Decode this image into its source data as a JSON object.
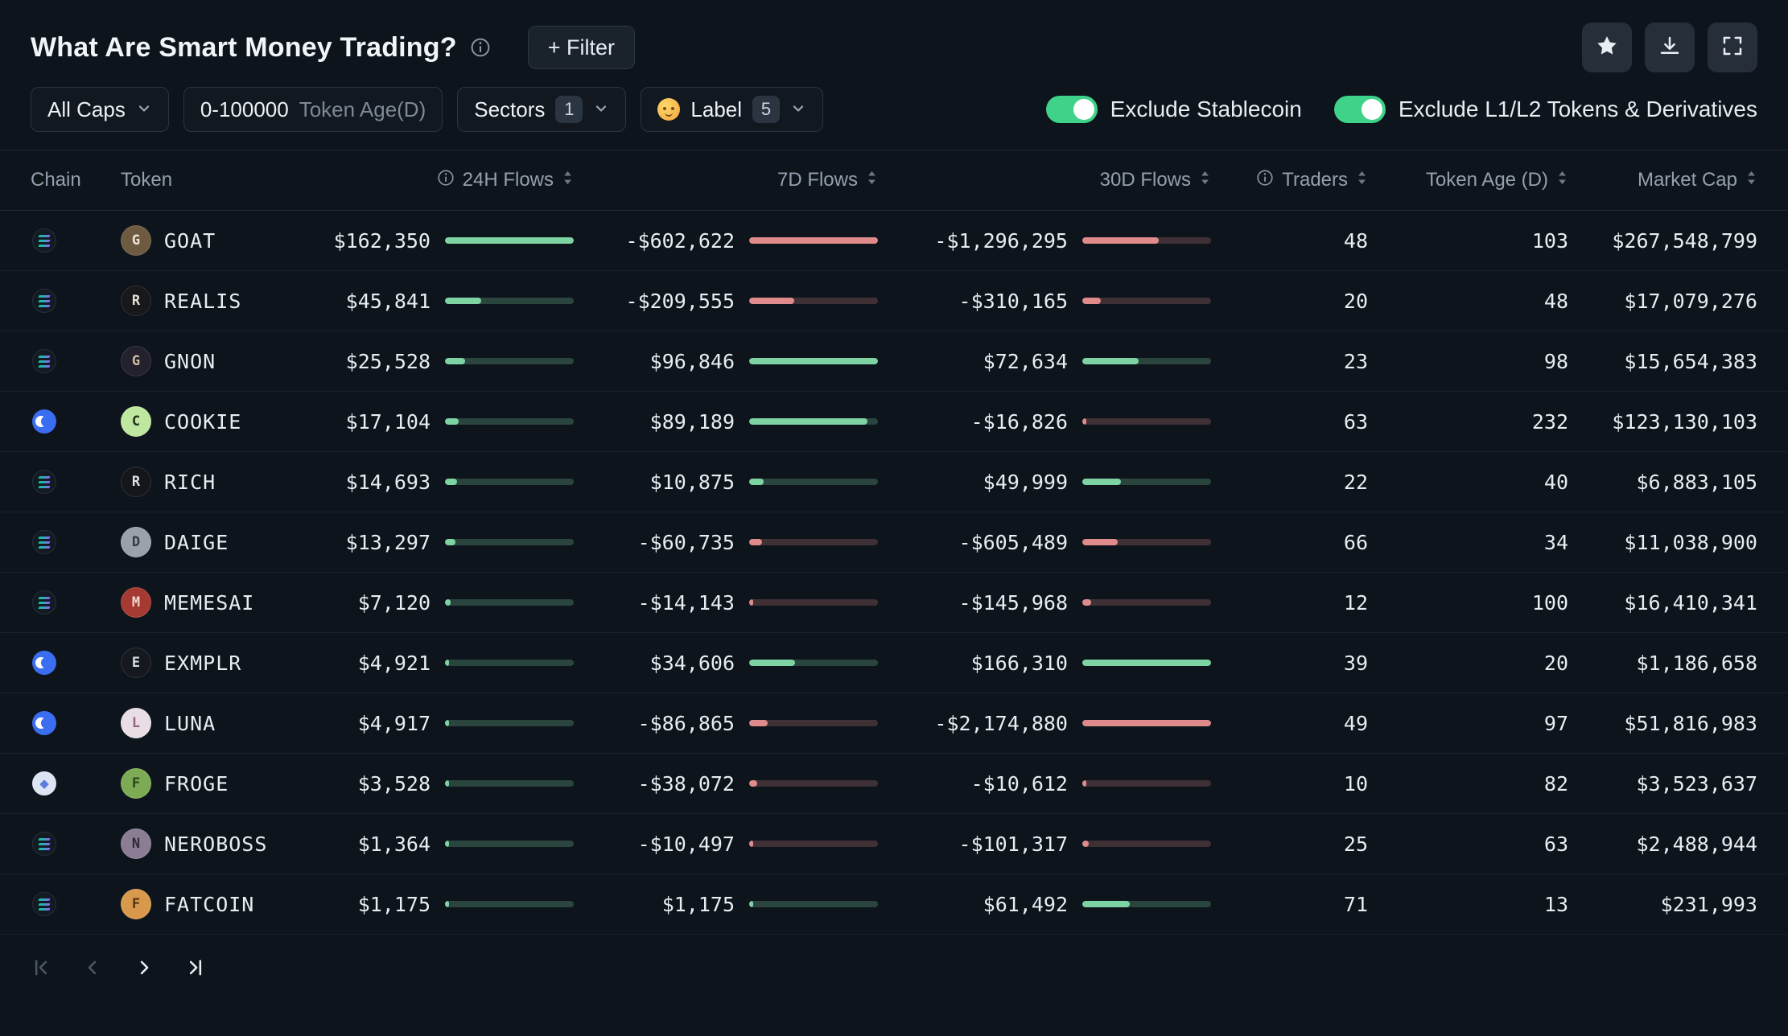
{
  "page": {
    "title": "What Are Smart Money Trading?",
    "filter_button": "+ Filter"
  },
  "toolbar": {
    "action_icons": [
      "star",
      "download",
      "fullscreen"
    ]
  },
  "filters": {
    "caps": {
      "label": "All Caps"
    },
    "token_age": {
      "value": "0-100000",
      "label": "Token Age(D)"
    },
    "sectors": {
      "label": "Sectors",
      "count": "1"
    },
    "label": {
      "icon": "cowboy-face-emoji",
      "label": "Label",
      "count": "5"
    }
  },
  "toggles": {
    "stablecoin": {
      "label": "Exclude Stablecoin",
      "on": true
    },
    "l1l2": {
      "label": "Exclude L1/L2 Tokens & Derivatives",
      "on": true
    }
  },
  "table": {
    "columns": [
      {
        "label": "Chain",
        "sortable": false
      },
      {
        "label": "Token",
        "sortable": false
      },
      {
        "label": "24H Flows",
        "info": true,
        "sortable": true
      },
      {
        "label": "7D Flows",
        "sortable": true
      },
      {
        "label": "30D Flows",
        "sortable": true
      },
      {
        "label": "Traders",
        "info": true,
        "sortable": true
      },
      {
        "label": "Token Age (D)",
        "sortable": true
      },
      {
        "label": "Market Cap",
        "sortable": true
      }
    ],
    "rows": [
      {
        "chain": "solana",
        "token": "GOAT",
        "flows": {
          "h24": 162350,
          "d7": -602622,
          "d30": -1296295
        },
        "traders": 48,
        "token_age": 103,
        "market_cap": 267548799,
        "avatar": {
          "bg": "#6d5a41",
          "fg": "#f0e6d8"
        }
      },
      {
        "chain": "solana",
        "token": "REALIS",
        "flows": {
          "h24": 45841,
          "d7": -209555,
          "d30": -310165
        },
        "traders": 20,
        "token_age": 48,
        "market_cap": 17079276,
        "avatar": {
          "bg": "#17171c",
          "fg": "#e8e2d2"
        }
      },
      {
        "chain": "solana",
        "token": "GNON",
        "flows": {
          "h24": 25528,
          "d7": 96846,
          "d30": 72634
        },
        "traders": 23,
        "token_age": 98,
        "market_cap": 15654383,
        "avatar": {
          "bg": "#24212c",
          "fg": "#cdbfa4"
        }
      },
      {
        "chain": "base",
        "token": "COOKIE",
        "flows": {
          "h24": 17104,
          "d7": 89189,
          "d30": -16826
        },
        "traders": 63,
        "token_age": 232,
        "market_cap": 123130103,
        "avatar": {
          "bg": "#bfe7a0",
          "fg": "#23301c"
        }
      },
      {
        "chain": "solana",
        "token": "RICH",
        "flows": {
          "h24": 14693,
          "d7": 10875,
          "d30": 49999
        },
        "traders": 22,
        "token_age": 40,
        "market_cap": 6883105,
        "avatar": {
          "bg": "#14161b",
          "fg": "#dfe3e8"
        }
      },
      {
        "chain": "solana",
        "token": "DAIGE",
        "flows": {
          "h24": 13297,
          "d7": -60735,
          "d30": -605489
        },
        "traders": 66,
        "token_age": 34,
        "market_cap": 11038900,
        "avatar": {
          "bg": "#9aa1a9",
          "fg": "#343a42"
        }
      },
      {
        "chain": "solana",
        "token": "MEMESAI",
        "flows": {
          "h24": 7120,
          "d7": -14143,
          "d30": -145968
        },
        "traders": 12,
        "token_age": 100,
        "market_cap": 16410341,
        "avatar": {
          "bg": "#a63a33",
          "fg": "#f2d8d0"
        }
      },
      {
        "chain": "base",
        "token": "EXMPLR",
        "flows": {
          "h24": 4921,
          "d7": 34606,
          "d30": 166310
        },
        "traders": 39,
        "token_age": 20,
        "market_cap": 1186658,
        "avatar": {
          "bg": "#15181f",
          "fg": "#d6dde6"
        }
      },
      {
        "chain": "base",
        "token": "LUNA",
        "flows": {
          "h24": 4917,
          "d7": -86865,
          "d30": -2174880
        },
        "traders": 49,
        "token_age": 97,
        "market_cap": 51816983,
        "avatar": {
          "bg": "#e9dde6",
          "fg": "#97627f"
        }
      },
      {
        "chain": "ethereum",
        "token": "FROGE",
        "flows": {
          "h24": 3528,
          "d7": -38072,
          "d30": -10612
        },
        "traders": 10,
        "token_age": 82,
        "market_cap": 3523637,
        "avatar": {
          "bg": "#7dab55",
          "fg": "#2c4519"
        }
      },
      {
        "chain": "solana",
        "token": "NEROBOSS",
        "flows": {
          "h24": 1364,
          "d7": -10497,
          "d30": -101317
        },
        "traders": 25,
        "token_age": 63,
        "market_cap": 2488944,
        "avatar": {
          "bg": "#8b7e94",
          "fg": "#2e2838"
        }
      },
      {
        "chain": "solana",
        "token": "FATCOIN",
        "flows": {
          "h24": 1175,
          "d7": 1175,
          "d30": 61492
        },
        "traders": 71,
        "token_age": 13,
        "market_cap": 231993,
        "avatar": {
          "bg": "#d9994d",
          "fg": "#4f3410"
        }
      }
    ]
  },
  "pagination": {
    "buttons": [
      {
        "name": "first-page",
        "enabled": false
      },
      {
        "name": "previous-page",
        "enabled": false
      },
      {
        "name": "next-page",
        "enabled": true
      },
      {
        "name": "last-page",
        "enabled": true
      }
    ]
  },
  "colors": {
    "positive": "#7ed3a2",
    "negative": "#e08b8b",
    "toggle_on": "#3fd38a",
    "base_chain_blue": "#3a6df0",
    "background": "#0d141c"
  }
}
